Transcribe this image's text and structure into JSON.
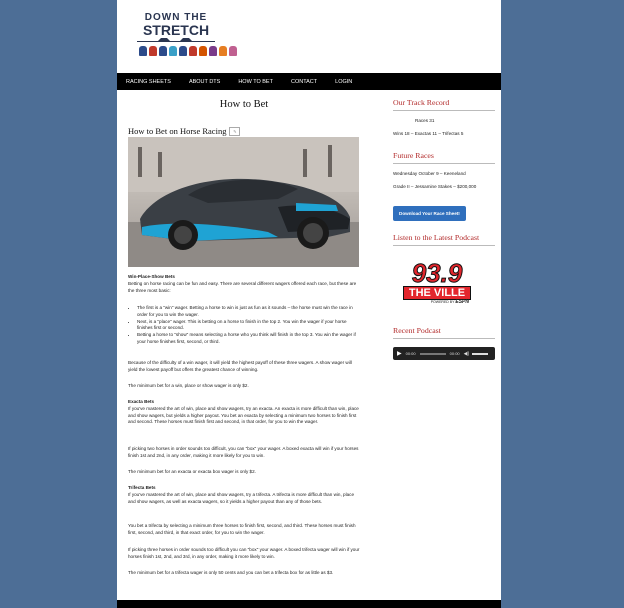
{
  "site": {
    "logo_line1": "DOWN THE",
    "logo_line2": "STRETCH",
    "jockey_colors": [
      "#2c4b8a",
      "#c0392b",
      "#2c4b8a",
      "#3aa0c8",
      "#2c4b8a",
      "#c0392b",
      "#d35400",
      "#7a3b8a",
      "#e67e22",
      "#c06090"
    ]
  },
  "nav": {
    "items": [
      "RACING SHEETS",
      "ABOUT DTS",
      "HOW TO BET",
      "CONTACT",
      "LOGIN"
    ]
  },
  "main": {
    "page_title": "How to Bet",
    "article_title": "How to Bet on Horse Racing",
    "wps_heading": "Win-Place-Show Bets",
    "wps_intro": "Betting on horse racing can be fun and easy. There are several different wagers offered each race, but these are the three most basic:",
    "bullets": [
      "The first is a \"win\" wager. Betting a horse to win is just as fun as it sounds – the horse must win the race in order for you to win the wager.",
      "Next, is a \"place\" wager. This is betting on a horse to finish in the top 2. You win the wager if your horse finishes first or second.",
      "Betting a horse to \"show\" means selecting a horse who you think will finish in the top 3. You win the wager if your horse finishes first, second, or third."
    ],
    "wps_payoff": "Because of the difficulty of a win wager, it will yield the highest payoff of these three wagers. A show wager will yield the lowest payoff but offers the greatest chance of winning.",
    "wps_min": "The minimum bet for a win, place or show wager is only $2.",
    "exacta_heading": "Exacta Bets",
    "exacta_p1": "If you've mastered the art of win, place and show wagers, try an exacta. An exacta is more difficult than win, place and show wagers, but yields a higher payout. You bet an exacta by selecting a minimum two horses to finish first and second. These horses must finish first and second, in that order, for you to win the wager.",
    "exacta_p2": "If picking two horses in order sounds too difficult, you can \"box\" your wager. A boxed exacta will win if your horses finish 1st and 2nd, in any order, making it more likely for you to win.",
    "exacta_min": "The minimum bet for an exacta or exacta box wager is only $2.",
    "trifecta_heading": "Trifecta Bets",
    "trifecta_p1": "If you've mastered the art of win, place and show wagers, try a trifecta. A trifecta is more difficult than win, place and show wagers, as well as exacta wagers, so it yields a higher payout than any of those bets.",
    "trifecta_p2": "You bet a trifecta by selecting a minimum three horses to finish first, second, and third. These horses must finish first, second, and third, in that exact order, for you to win the wager.",
    "trifecta_p3": "If picking three horses in order sounds too difficult you can \"box\" your wager. A boxed trifecta wager will win if your horses finish 1st, 2nd, and 3rd, in any order, making it more likely to win.",
    "trifecta_min": "The minimum bet for a trifecta wager is only 50 cents and you can bet a trifecta box for as little as $3."
  },
  "sidebar": {
    "track_title": "Our Track Record",
    "races": "Races 31",
    "wins": "Wins 18 – Exactas 11 – Trifectas 5",
    "future_title": "Future Races",
    "future_line1": "Wednesday October 9 – Keeneland",
    "future_line2": "Grade II – Jessamine Stakes – $200,000",
    "download_button": "Download Your Race Sheet!",
    "podcast_title": "Listen to the Latest Podcast",
    "podcast_logo_number": "93.9",
    "podcast_logo_name": "THE VILLE",
    "podcast_logo_powered": "POWERED BY",
    "podcast_logo_brand": "ESPN",
    "recent_title": "Recent Podcast",
    "audio_time_start": "00:00",
    "audio_time_end": "00:00"
  }
}
